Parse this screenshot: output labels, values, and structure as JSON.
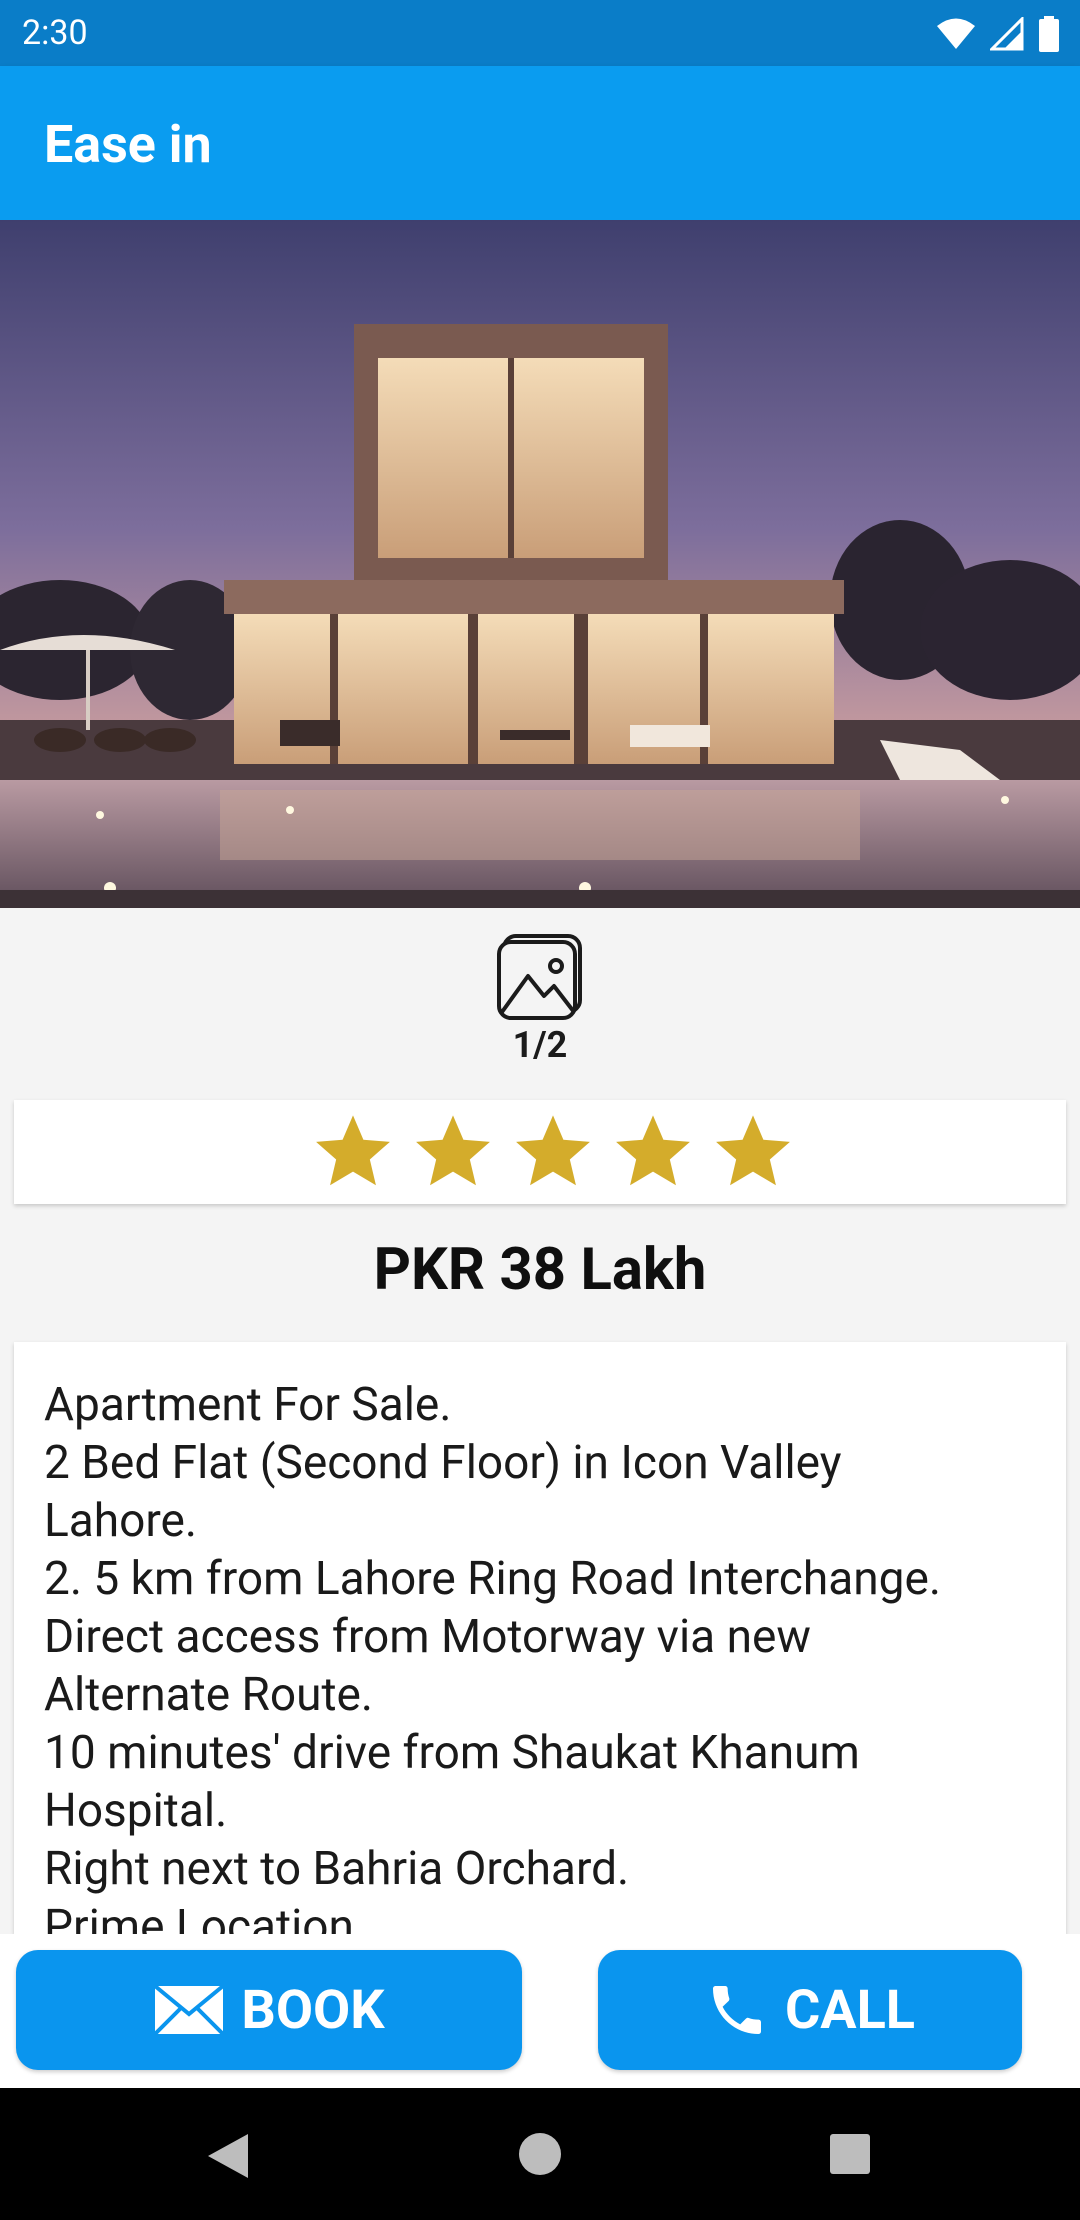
{
  "status_bar": {
    "time": "2:30",
    "icons": [
      "wifi-icon",
      "signal-icon",
      "battery-icon"
    ]
  },
  "app_bar": {
    "title": "Ease in",
    "color": "#0a9cf0"
  },
  "gallery": {
    "icon": "gallery-icon",
    "count": "1/2"
  },
  "rating": {
    "stars": 5,
    "max": 5,
    "star_color": "#d4ac2b"
  },
  "listing": {
    "price": "PKR 38 Lakh",
    "description_lines": [
      "Apartment For Sale.",
      "2 Bed Flat (Second Floor) in Icon Valley",
      "Lahore.",
      "2. 5 km from Lahore Ring Road Interchange.",
      "Direct access from Motorway via new",
      "Alternate Route.",
      "10 minutes' drive from Shaukat Khanum",
      "Hospital.",
      "Right next to Bahria Orchard.",
      "Prime Location."
    ]
  },
  "actions": {
    "book_label": "BOOK",
    "book_icon": "mail-icon",
    "call_label": "CALL",
    "call_icon": "phone-icon",
    "button_color": "#0a95ee"
  },
  "nav_bar": {
    "icons": [
      "back-icon",
      "home-icon",
      "recents-icon"
    ]
  }
}
